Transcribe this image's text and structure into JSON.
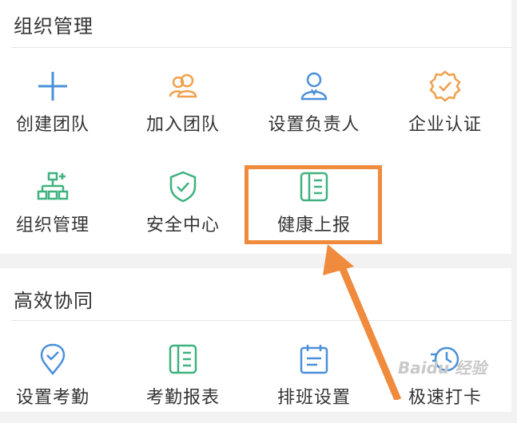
{
  "colors": {
    "icon_blue": "#4a90d9",
    "icon_orange": "#f0a04b",
    "icon_green": "#3fb27f",
    "highlight_orange": "#f08a3c"
  },
  "org_section": {
    "title": "组织管理",
    "items": [
      {
        "label": "创建团队",
        "icon": "plus-icon"
      },
      {
        "label": "加入团队",
        "icon": "people-icon"
      },
      {
        "label": "设置负责人",
        "icon": "person-icon"
      },
      {
        "label": "企业认证",
        "icon": "badge-check-icon"
      },
      {
        "label": "组织管理",
        "icon": "org-chart-icon"
      },
      {
        "label": "安全中心",
        "icon": "shield-check-icon"
      },
      {
        "label": "健康上报",
        "icon": "book-icon"
      }
    ]
  },
  "collab_section": {
    "title": "高效协同",
    "items": [
      {
        "label": "设置考勤",
        "icon": "location-check-icon"
      },
      {
        "label": "考勤报表",
        "icon": "book-icon"
      },
      {
        "label": "排班设置",
        "icon": "calendar-icon"
      },
      {
        "label": "极速打卡",
        "icon": "fast-clock-icon"
      }
    ]
  },
  "watermark": "Baidu 经验"
}
